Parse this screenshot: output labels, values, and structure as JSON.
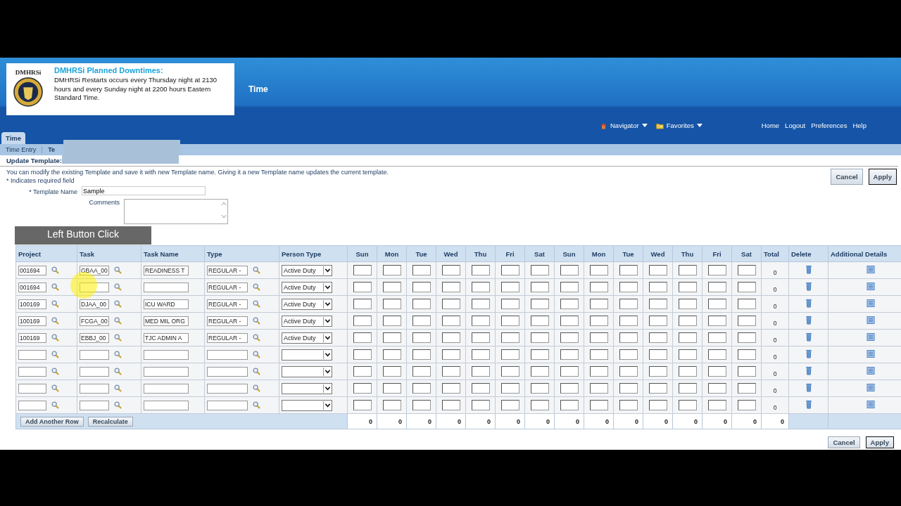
{
  "banner": {
    "logo_text": "DMHRSi",
    "title": "DMHRSi Planned Downtimes:",
    "message": "DMHRSi Restarts occurs every Thursday night at 2130 hours and every Sunday night at 2200 hours Eastern Standard Time."
  },
  "app_title": "Time",
  "global_menus": [
    {
      "label": "Navigator",
      "kind": "home"
    },
    {
      "label": "Favorites",
      "kind": "folder"
    }
  ],
  "global_links": [
    "Home",
    "Logout",
    "Preferences",
    "Help"
  ],
  "tabs": [
    {
      "label": "Time",
      "selected": true
    }
  ],
  "subtabs": [
    {
      "label": "Time Entry",
      "selected": false
    },
    {
      "label": "Te",
      "selected": true
    }
  ],
  "page_title": "Update Template:",
  "instructions": "You can modify the existing Template and save it with new Template name. Giving it a new Template name updates the current template.",
  "required_note": "* Indicates required field",
  "form": {
    "template_name_label": "* Template Name",
    "template_name": "Sample",
    "comments_label": "Comments"
  },
  "top_buttons": [
    "Cancel",
    "Apply"
  ],
  "overlay_caption": "Left Button Click",
  "table": {
    "columns": [
      "Project",
      "Task",
      "Task Name",
      "Type",
      "Person Type"
    ],
    "day_columns": [
      "Sun",
      "Mon",
      "Tue",
      "Wed",
      "Thu",
      "Fri",
      "Sat",
      "Sun",
      "Mon",
      "Tue",
      "Wed",
      "Thu",
      "Fri",
      "Sat"
    ],
    "end_columns": [
      "Total",
      "Delete",
      "Additional Details"
    ],
    "rows": [
      {
        "project": "001694",
        "task": "GBAA_00",
        "task_name": "READINESS T",
        "type": "REGULAR -",
        "person_type": "Active Duty",
        "total": "0"
      },
      {
        "project": "001694",
        "type": "REGULAR -",
        "person_type": "Active Duty",
        "total": "0"
      },
      {
        "project": "100169",
        "task": "DJAA_00",
        "task_name": "ICU WARD",
        "type": "REGULAR -",
        "person_type": "Active Duty",
        "total": "0"
      },
      {
        "project": "100169",
        "task": "FCGA_00",
        "task_name": "MED MIL ORG",
        "type": "REGULAR -",
        "person_type": "Active Duty",
        "total": "0"
      },
      {
        "project": "100169",
        "task": "EBBJ_00",
        "task_name": "TJC ADMIN A",
        "type": "REGULAR -",
        "person_type": "Active Duty",
        "total": "0"
      },
      {
        "total": "0"
      },
      {
        "total": "0"
      },
      {
        "total": "0"
      },
      {
        "total": "0"
      }
    ],
    "footer_buttons": [
      "Add Another Row",
      "Recalculate"
    ],
    "totals": [
      "0",
      "0",
      "0",
      "0",
      "0",
      "0",
      "0",
      "0",
      "0",
      "0",
      "0",
      "0",
      "0",
      "0",
      "0"
    ]
  },
  "bottom_buttons": [
    "Cancel",
    "Apply"
  ]
}
